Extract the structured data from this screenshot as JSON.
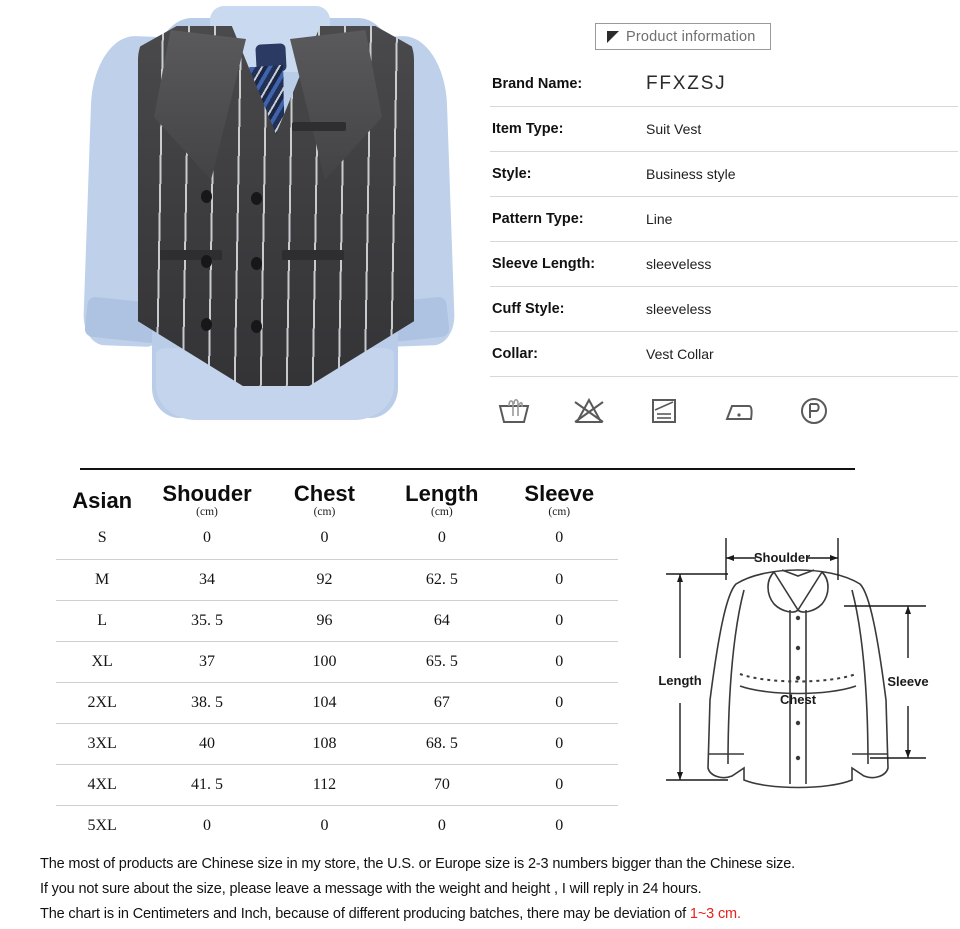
{
  "product_info": {
    "badge_label": "Product information",
    "badge_icon": "flag-triangle-icon",
    "specs": [
      {
        "label": "Brand Name:",
        "value": "FFXZSJ",
        "is_brand": true
      },
      {
        "label": "Item Type:",
        "value": "Suit Vest"
      },
      {
        "label": "Style:",
        "value": "Business style"
      },
      {
        "label": "Pattern Type:",
        "value": "Line"
      },
      {
        "label": "Sleeve Length:",
        "value": "sleeveless"
      },
      {
        "label": "Cuff Style:",
        "value": "sleeveless"
      },
      {
        "label": "Collar:",
        "value": "Vest Collar"
      }
    ],
    "care_icons": [
      "hand-wash-tub-icon",
      "do-not-bleach-icon",
      "line-dry-icon",
      "iron-low-heat-icon",
      "dry-clean-petroleum-icon"
    ]
  },
  "product_photo": {
    "alt": "mens-pinstripe-double-breasted-suit-vest",
    "vest_color": "#3f3f42",
    "shirt_color": "#bed0ea",
    "tie_color": "#223257"
  },
  "size_chart": {
    "columns": [
      {
        "name": "Asian",
        "unit": ""
      },
      {
        "name": "Shouder",
        "unit": "(cm)"
      },
      {
        "name": "Chest",
        "unit": "(cm)"
      },
      {
        "name": "Length",
        "unit": "(cm)"
      },
      {
        "name": "Sleeve",
        "unit": "(cm)"
      }
    ],
    "rows": [
      {
        "size": "S",
        "shoulder": "0",
        "chest": "0",
        "length": "0",
        "sleeve": "0"
      },
      {
        "size": "M",
        "shoulder": "34",
        "chest": "92",
        "length": "62. 5",
        "sleeve": "0"
      },
      {
        "size": "L",
        "shoulder": "35. 5",
        "chest": "96",
        "length": "64",
        "sleeve": "0"
      },
      {
        "size": "XL",
        "shoulder": "37",
        "chest": "100",
        "length": "65. 5",
        "sleeve": "0"
      },
      {
        "size": "2XL",
        "shoulder": "38. 5",
        "chest": "104",
        "length": "67",
        "sleeve": "0"
      },
      {
        "size": "3XL",
        "shoulder": "40",
        "chest": "108",
        "length": "68. 5",
        "sleeve": "0"
      },
      {
        "size": "4XL",
        "shoulder": "41. 5",
        "chest": "112",
        "length": "70",
        "sleeve": "0"
      },
      {
        "size": "5XL",
        "shoulder": "0",
        "chest": "0",
        "length": "0",
        "sleeve": "0"
      }
    ]
  },
  "measure_diagram": {
    "labels": {
      "shoulder": "Shoulder",
      "length": "Length",
      "chest": "Chest",
      "sleeve": "Sleeve"
    }
  },
  "footer": {
    "line1": "The most of products are Chinese size in my store, the U.S. or Europe size is 2-3 numbers bigger than the Chinese size.",
    "line2": "If you not sure about the size, please leave a message with the weight and height , I will reply in 24 hours.",
    "line3_prefix": "The chart is in Centimeters and Inch, because of different producing batches, there may be deviation of ",
    "line3_accent": "1~3 cm.",
    "accent_color": "#e8221c"
  }
}
